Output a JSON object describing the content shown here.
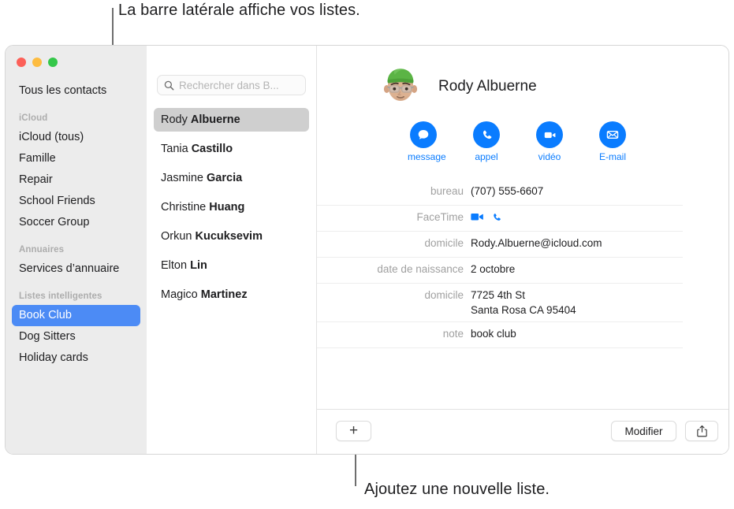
{
  "callouts": {
    "top": "La barre latérale affiche vos listes.",
    "bottom": "Ajoutez une nouvelle liste."
  },
  "window": {
    "traffic_lights": {
      "close_color": "#fc6058",
      "minimize_color": "#fdbc40",
      "maximize_color": "#34c749"
    }
  },
  "sidebar": {
    "all_contacts": "Tous les contacts",
    "groups": [
      {
        "header": "iCloud",
        "items": [
          {
            "label": "iCloud (tous)",
            "selected": false
          },
          {
            "label": "Famille",
            "selected": false
          },
          {
            "label": "Repair",
            "selected": false
          },
          {
            "label": "School Friends",
            "selected": false
          },
          {
            "label": "Soccer Group",
            "selected": false
          }
        ]
      },
      {
        "header": "Annuaires",
        "items": [
          {
            "label": "Services d’annuaire",
            "selected": false
          }
        ]
      },
      {
        "header": "Listes intelligentes",
        "items": [
          {
            "label": "Book Club",
            "selected": true
          },
          {
            "label": "Dog Sitters",
            "selected": false
          },
          {
            "label": "Holiday cards",
            "selected": false
          }
        ]
      }
    ],
    "selection_color": "#4c8bf5"
  },
  "search": {
    "placeholder": "Rechercher dans B...",
    "value": "",
    "icon": "search-icon"
  },
  "contact_list": [
    {
      "first": "Rody",
      "last": "Albuerne",
      "selected": true
    },
    {
      "first": "Tania",
      "last": "Castillo",
      "selected": false
    },
    {
      "first": "Jasmine",
      "last": "Garcia",
      "selected": false
    },
    {
      "first": "Christine",
      "last": "Huang",
      "selected": false
    },
    {
      "first": "Orkun",
      "last": "Kucuksevim",
      "selected": false
    },
    {
      "first": "Elton",
      "last": "Lin",
      "selected": false
    },
    {
      "first": "Magico",
      "last": "Martinez",
      "selected": false
    }
  ],
  "detail": {
    "name": "Rody Albuerne",
    "avatar": "memoji-avatar",
    "accent_color": "#0a7cff",
    "actions": [
      {
        "label": "message",
        "icon": "message-bubble-icon"
      },
      {
        "label": "appel",
        "icon": "phone-icon"
      },
      {
        "label": "vidéo",
        "icon": "video-camera-icon"
      },
      {
        "label": "E-mail",
        "icon": "envelope-icon"
      }
    ],
    "fields": [
      {
        "label": "bureau",
        "value": "(707) 555-6607",
        "type": "text"
      },
      {
        "label": "FaceTime",
        "value": "",
        "type": "facetime"
      },
      {
        "label": "domicile",
        "value": "Rody.Albuerne@icloud.com",
        "type": "text"
      },
      {
        "label": "date de naissance",
        "value": "2 octobre",
        "type": "text"
      },
      {
        "label": "domicile",
        "value": "7725 4th St\nSanta Rosa CA 95404",
        "type": "text"
      },
      {
        "label": "note",
        "value": "book club",
        "type": "text"
      }
    ]
  },
  "bottom_bar": {
    "add_list_label": "+",
    "edit_label": "Modifier",
    "share_icon": "share-icon"
  }
}
